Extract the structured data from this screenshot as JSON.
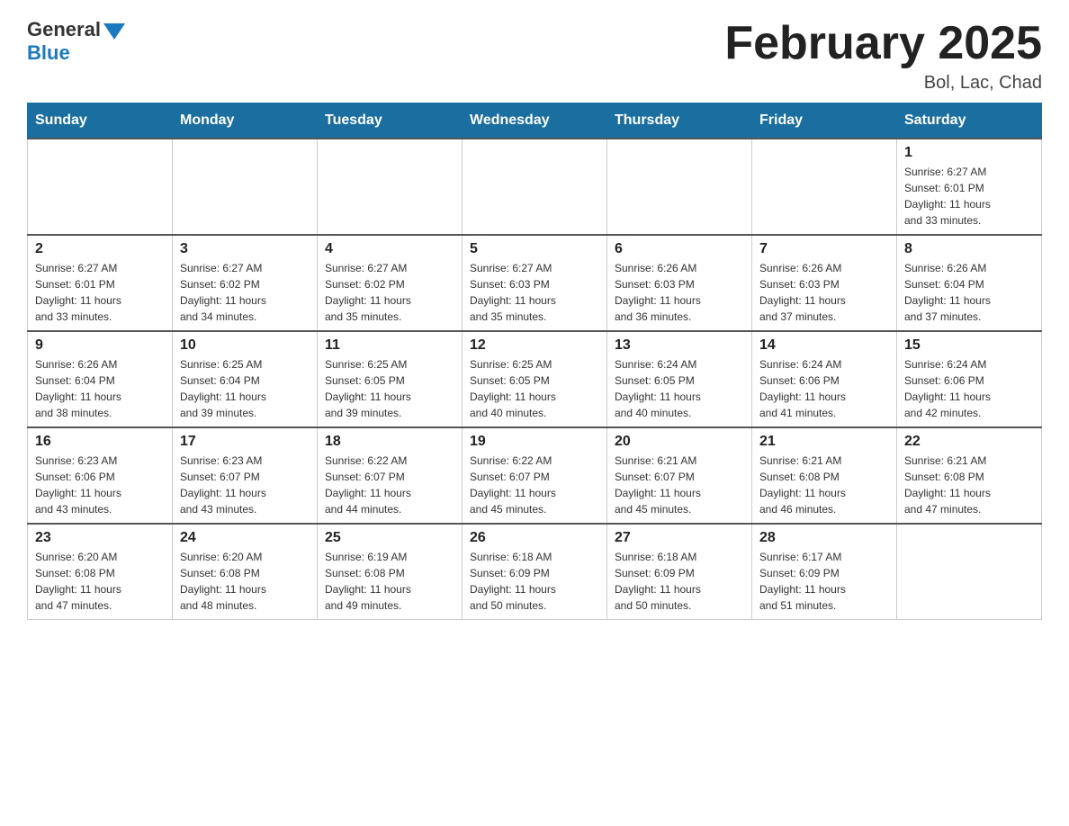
{
  "logo": {
    "general": "General",
    "blue": "Blue"
  },
  "title": "February 2025",
  "subtitle": "Bol, Lac, Chad",
  "days_of_week": [
    "Sunday",
    "Monday",
    "Tuesday",
    "Wednesday",
    "Thursday",
    "Friday",
    "Saturday"
  ],
  "weeks": [
    [
      {
        "day": "",
        "info": ""
      },
      {
        "day": "",
        "info": ""
      },
      {
        "day": "",
        "info": ""
      },
      {
        "day": "",
        "info": ""
      },
      {
        "day": "",
        "info": ""
      },
      {
        "day": "",
        "info": ""
      },
      {
        "day": "1",
        "info": "Sunrise: 6:27 AM\nSunset: 6:01 PM\nDaylight: 11 hours\nand 33 minutes."
      }
    ],
    [
      {
        "day": "2",
        "info": "Sunrise: 6:27 AM\nSunset: 6:01 PM\nDaylight: 11 hours\nand 33 minutes."
      },
      {
        "day": "3",
        "info": "Sunrise: 6:27 AM\nSunset: 6:02 PM\nDaylight: 11 hours\nand 34 minutes."
      },
      {
        "day": "4",
        "info": "Sunrise: 6:27 AM\nSunset: 6:02 PM\nDaylight: 11 hours\nand 35 minutes."
      },
      {
        "day": "5",
        "info": "Sunrise: 6:27 AM\nSunset: 6:03 PM\nDaylight: 11 hours\nand 35 minutes."
      },
      {
        "day": "6",
        "info": "Sunrise: 6:26 AM\nSunset: 6:03 PM\nDaylight: 11 hours\nand 36 minutes."
      },
      {
        "day": "7",
        "info": "Sunrise: 6:26 AM\nSunset: 6:03 PM\nDaylight: 11 hours\nand 37 minutes."
      },
      {
        "day": "8",
        "info": "Sunrise: 6:26 AM\nSunset: 6:04 PM\nDaylight: 11 hours\nand 37 minutes."
      }
    ],
    [
      {
        "day": "9",
        "info": "Sunrise: 6:26 AM\nSunset: 6:04 PM\nDaylight: 11 hours\nand 38 minutes."
      },
      {
        "day": "10",
        "info": "Sunrise: 6:25 AM\nSunset: 6:04 PM\nDaylight: 11 hours\nand 39 minutes."
      },
      {
        "day": "11",
        "info": "Sunrise: 6:25 AM\nSunset: 6:05 PM\nDaylight: 11 hours\nand 39 minutes."
      },
      {
        "day": "12",
        "info": "Sunrise: 6:25 AM\nSunset: 6:05 PM\nDaylight: 11 hours\nand 40 minutes."
      },
      {
        "day": "13",
        "info": "Sunrise: 6:24 AM\nSunset: 6:05 PM\nDaylight: 11 hours\nand 40 minutes."
      },
      {
        "day": "14",
        "info": "Sunrise: 6:24 AM\nSunset: 6:06 PM\nDaylight: 11 hours\nand 41 minutes."
      },
      {
        "day": "15",
        "info": "Sunrise: 6:24 AM\nSunset: 6:06 PM\nDaylight: 11 hours\nand 42 minutes."
      }
    ],
    [
      {
        "day": "16",
        "info": "Sunrise: 6:23 AM\nSunset: 6:06 PM\nDaylight: 11 hours\nand 43 minutes."
      },
      {
        "day": "17",
        "info": "Sunrise: 6:23 AM\nSunset: 6:07 PM\nDaylight: 11 hours\nand 43 minutes."
      },
      {
        "day": "18",
        "info": "Sunrise: 6:22 AM\nSunset: 6:07 PM\nDaylight: 11 hours\nand 44 minutes."
      },
      {
        "day": "19",
        "info": "Sunrise: 6:22 AM\nSunset: 6:07 PM\nDaylight: 11 hours\nand 45 minutes."
      },
      {
        "day": "20",
        "info": "Sunrise: 6:21 AM\nSunset: 6:07 PM\nDaylight: 11 hours\nand 45 minutes."
      },
      {
        "day": "21",
        "info": "Sunrise: 6:21 AM\nSunset: 6:08 PM\nDaylight: 11 hours\nand 46 minutes."
      },
      {
        "day": "22",
        "info": "Sunrise: 6:21 AM\nSunset: 6:08 PM\nDaylight: 11 hours\nand 47 minutes."
      }
    ],
    [
      {
        "day": "23",
        "info": "Sunrise: 6:20 AM\nSunset: 6:08 PM\nDaylight: 11 hours\nand 47 minutes."
      },
      {
        "day": "24",
        "info": "Sunrise: 6:20 AM\nSunset: 6:08 PM\nDaylight: 11 hours\nand 48 minutes."
      },
      {
        "day": "25",
        "info": "Sunrise: 6:19 AM\nSunset: 6:08 PM\nDaylight: 11 hours\nand 49 minutes."
      },
      {
        "day": "26",
        "info": "Sunrise: 6:18 AM\nSunset: 6:09 PM\nDaylight: 11 hours\nand 50 minutes."
      },
      {
        "day": "27",
        "info": "Sunrise: 6:18 AM\nSunset: 6:09 PM\nDaylight: 11 hours\nand 50 minutes."
      },
      {
        "day": "28",
        "info": "Sunrise: 6:17 AM\nSunset: 6:09 PM\nDaylight: 11 hours\nand 51 minutes."
      },
      {
        "day": "",
        "info": ""
      }
    ]
  ]
}
